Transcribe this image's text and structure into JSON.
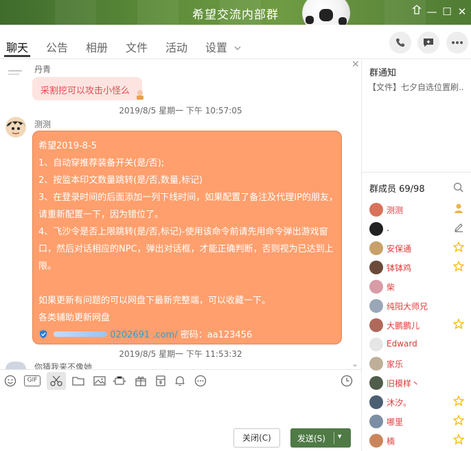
{
  "window": {
    "title": "希望交流内部群",
    "controls": {
      "skin": "skin-icon",
      "minimize": "—",
      "maximize": "☐",
      "close": "✕"
    }
  },
  "tabs": [
    {
      "label": "聊天",
      "active": true
    },
    {
      "label": "公告"
    },
    {
      "label": "相册"
    },
    {
      "label": "文件"
    },
    {
      "label": "活动"
    },
    {
      "label": "设置"
    }
  ],
  "header_actions": [
    "phone-icon",
    "message-icon",
    "more-icon"
  ],
  "messages": [
    {
      "sender": "丹青",
      "text": "采割挖可以攻击小怪么",
      "style": "pink"
    },
    {
      "timestamp": "2019/8/5 星期一 下午 10:57:05"
    },
    {
      "sender": "测测",
      "style": "orange",
      "lines": [
        "希望2019-8-5",
        "1、自动穿推荐装备开关(是/否);",
        "2、按监本印文数量跳转(是/否,数量,标记)",
        "3、在登录时间的后面添加一列下线时间，如果配置了备注及代理IP的朋友，",
        "请重新配置一下，因为错位了。",
        "4、飞沙令是否上限跳转(是/否,标记)-使用该命令前请先用命令弹出游戏窗",
        "口，然后对话相应的NPC，弹出对话框，才能正确判断，否则视为已达到上",
        "限。",
        "",
        "如果更新有问题的可以网盘下最新完整端，可以收藏一下。",
        "各类辅助更新网盘"
      ],
      "link_text": "0202691 .com/",
      "password_text": "密码：aa123456"
    },
    {
      "timestamp": "2019/8/5 星期一 下午 11:53:32"
    },
    {
      "sender": "你猜我来不像她"
    }
  ],
  "toolbar": {
    "icons": [
      "emoji-icon",
      "gif-icon",
      "screenshot-icon",
      "folder-icon",
      "image-icon",
      "shake-icon",
      "gift-icon",
      "redpacket-icon",
      "bell-icon",
      "more-dots-icon",
      "history-icon"
    ],
    "gif_label": "GIF"
  },
  "buttons": {
    "close_label": "关闭(C)",
    "send_label": "发送(S)"
  },
  "right_panel": {
    "notice_title": "群通知",
    "notice_text": "【文件】七夕自选位置刷...",
    "members_title": "群成员 69/98",
    "members": [
      {
        "name": "测测",
        "color": "#e03a3a",
        "badge": "owner"
      },
      {
        "name": ".",
        "color": "#222222",
        "badge": "edit"
      },
      {
        "name": "安保通",
        "color": "#e03a3a",
        "badge": "star"
      },
      {
        "name": "钵钵鸡",
        "color": "#e03a3a",
        "badge": "star"
      },
      {
        "name": "柴",
        "color": "#e03a3a",
        "badge": ""
      },
      {
        "name": "纯阳大师兄",
        "color": "#e03a3a",
        "badge": ""
      },
      {
        "name": "大鹏鹏儿",
        "color": "#e03a3a",
        "badge": "star"
      },
      {
        "name": "Edward",
        "color": "#e03a3a",
        "badge": ""
      },
      {
        "name": "家乐",
        "color": "#e03a3a",
        "badge": ""
      },
      {
        "name": "旧模样丶",
        "color": "#e03a3a",
        "badge": ""
      },
      {
        "name": "沐汐。",
        "color": "#e03a3a",
        "badge": "star"
      },
      {
        "name": "哪里",
        "color": "#e03a3a",
        "badge": "star"
      },
      {
        "name": "楠",
        "color": "#e03a3a",
        "badge": "star"
      }
    ]
  },
  "colors": {
    "accent_green": "#4f7a46",
    "bubble_orange": "#fe9f6d",
    "bubble_pink": "#fde4e1",
    "member_red": "#e03a3a",
    "star_gold": "#f5b800"
  }
}
